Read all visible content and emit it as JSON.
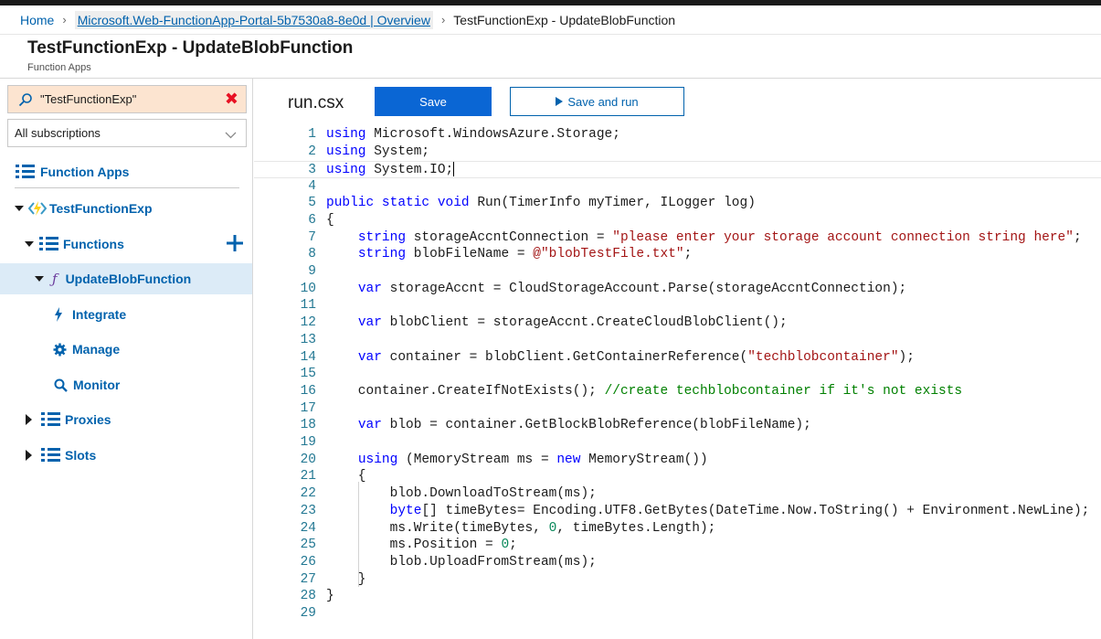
{
  "breadcrumb": {
    "home": "Home",
    "portal": "Microsoft.Web-FunctionApp-Portal-5b7530a8-8e0d | Overview",
    "current": "TestFunctionExp - UpdateBlobFunction"
  },
  "header": {
    "title": "TestFunctionExp - UpdateBlobFunction",
    "subtitle": "Function Apps"
  },
  "sidebar": {
    "search_value": "\"TestFunctionExp\"",
    "clear_label": "✖",
    "subscription": "All subscriptions",
    "function_apps": "Function Apps",
    "app_name": "TestFunctionExp",
    "functions": "Functions",
    "function_name": "UpdateBlobFunction",
    "integrate": "Integrate",
    "manage": "Manage",
    "monitor": "Monitor",
    "proxies": "Proxies",
    "slots": "Slots"
  },
  "editor": {
    "file_name": "run.csx",
    "save_label": "Save",
    "save_run_label": "Save and run",
    "line_numbers": [
      "1",
      "2",
      "3",
      "4",
      "5",
      "6",
      "7",
      "8",
      "9",
      "10",
      "11",
      "12",
      "13",
      "14",
      "15",
      "16",
      "17",
      "18",
      "19",
      "20",
      "21",
      "22",
      "23",
      "24",
      "25",
      "26",
      "27",
      "28",
      "29"
    ]
  },
  "colors": {
    "accent": "#0062ad",
    "save_button": "#0a66d4",
    "search_highlight": "#fce4d0",
    "selected_item": "#dcebf7",
    "keyword": "#0000ff",
    "string": "#a31515",
    "comment": "#008000",
    "number": "#09885a",
    "line_number": "#237893"
  }
}
